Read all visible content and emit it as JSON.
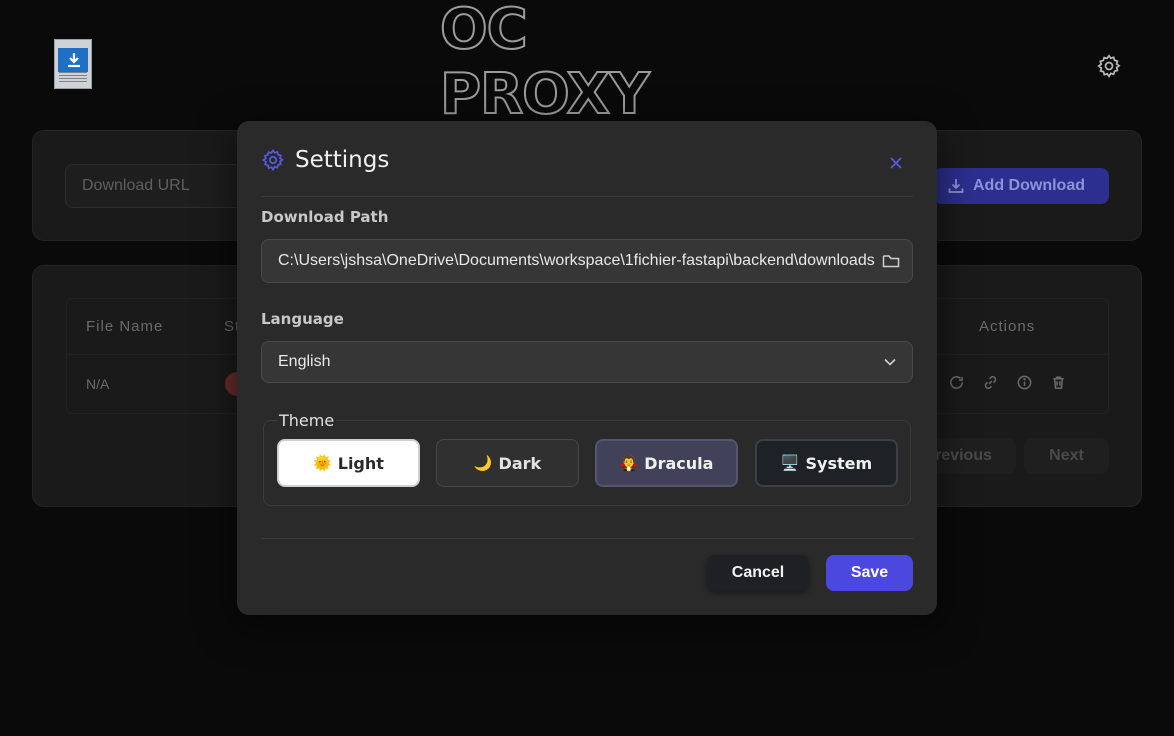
{
  "app": {
    "brand": "OC PROXY",
    "app_icon": "download-page-icon"
  },
  "download_bar": {
    "url_placeholder": "Download URL",
    "add_button": "Add Download"
  },
  "table": {
    "columns": [
      "File Name",
      "St",
      "Actions"
    ],
    "rows": [
      {
        "file_name": "N/A"
      }
    ],
    "row_action_icons": [
      "refresh-icon",
      "link-icon",
      "info-icon",
      "trash-icon"
    ]
  },
  "pagination": {
    "previous": "revious",
    "next": "Next"
  },
  "settings": {
    "title": "Settings",
    "download_path_label": "Download Path",
    "download_path_value": "C:\\Users\\jshsa\\OneDrive\\Documents\\workspace\\1fichier-fastapi\\backend\\downloads",
    "language_label": "Language",
    "language_value": "English",
    "theme_label": "Theme",
    "themes": [
      {
        "label": "Light",
        "emoji": "🌞"
      },
      {
        "label": "Dark",
        "emoji": "🌙"
      },
      {
        "label": "Dracula",
        "emoji": "🧛"
      },
      {
        "label": "System",
        "emoji": "🖥️"
      }
    ],
    "selected_theme": "Light",
    "cancel": "Cancel",
    "save": "Save"
  },
  "colors": {
    "accent": "#4b48e0",
    "background": "#0a0a0a",
    "modal": "#2a2a2a"
  }
}
